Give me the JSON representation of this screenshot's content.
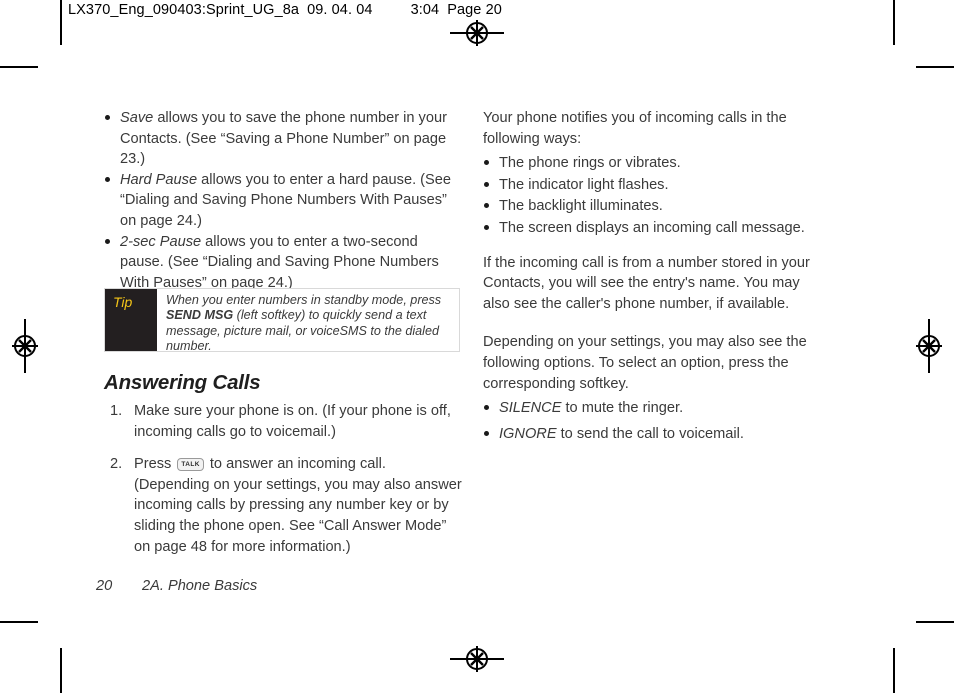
{
  "header": {
    "job_id": "LX370_Eng_090403:Sprint_UG_8a",
    "date": "09. 04. 04",
    "time": "3:04",
    "page_label": "Page 20"
  },
  "left_column": {
    "options_list": [
      {
        "term": "Save",
        "text": " allows you to save the phone number in your Contacts. (See “Saving a Phone Number” on page 23.)"
      },
      {
        "term": "Hard Pause",
        "text": " allows you to enter a hard pause. (See “Dialing and Saving Phone Numbers With Pauses” on page 24.)"
      },
      {
        "term": "2-sec Pause",
        "text": " allows you to enter a two-second pause. (See “Dialing and Saving Phone Numbers With Pauses” on page 24.)"
      }
    ],
    "tip": {
      "label": "Tip",
      "text_before": "When you enter numbers in standby mode, press ",
      "bold": "SEND MSG",
      "text_after": " (left softkey) to quickly send a text message, picture mail, or voiceSMS to the dialed number."
    },
    "heading": "Answering Calls",
    "steps": [
      {
        "number": "1.",
        "text": "Make sure your phone is on. (If your phone is off, incoming calls go to voicemail.)"
      },
      {
        "number": "2.",
        "text_before": "Press ",
        "key": "TALK",
        "text_after": " to answer an incoming call. (Depending on your settings, you may also answer incoming calls by  pressing any number key or by sliding the phone open. See “Call Answer Mode” on page 48 for more information.)"
      }
    ]
  },
  "right_column": {
    "intro": "Your phone notifies you of incoming calls in the following ways:",
    "notify_list": [
      "The phone rings or vibrates.",
      "The indicator light flashes.",
      "The backlight illuminates.",
      "The screen displays an incoming call message."
    ],
    "paragraph_1": "If the incoming call is from a number stored in your Contacts, you will see the entry's name. You may also see the caller's phone number, if available.",
    "paragraph_2": "Depending on your settings, you may also see the following options. To select an option, press the corresponding softkey.",
    "options_list": [
      {
        "term": "SILENCE",
        "text": " to mute the ringer."
      },
      {
        "term": "IGNORE",
        "text": " to send the call to voicemail."
      }
    ]
  },
  "footer": {
    "page_number": "20",
    "section": "2A. Phone Basics"
  },
  "colors": {
    "tip_label_bg": "#231f20",
    "tip_label_text": "#f5c518",
    "body_text": "#3a3a3a",
    "crop_mark": "#000000"
  }
}
